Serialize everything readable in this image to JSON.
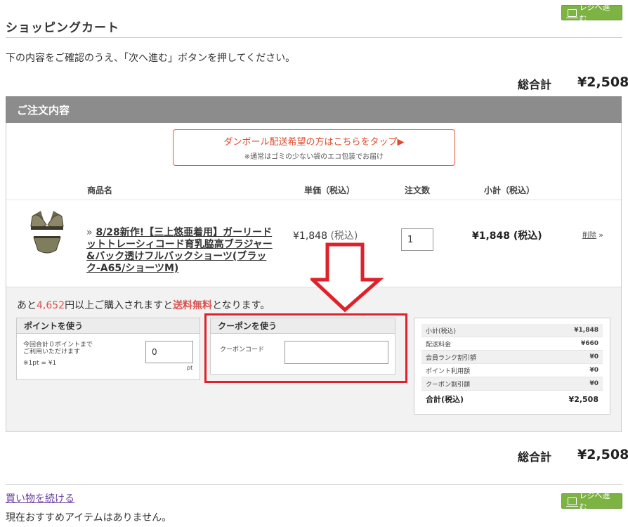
{
  "header": {
    "title": "ショッピングカート",
    "checkout_button": "レジへ進む"
  },
  "instruction": "下の内容をご確認のうえ、「次へ進む」ボタンを押してください。",
  "grand_total": {
    "label": "総合計",
    "value": "¥2,508"
  },
  "order": {
    "heading": "ご注文内容",
    "banner": {
      "line1": "ダンボール配送希望の方はこちらをタップ▶",
      "line2": "※通常はゴミの少ない袋のエコ包装でお届け"
    },
    "columns": {
      "product": "商品名",
      "unit_price": "単価（税込）",
      "quantity": "注文数",
      "subtotal": "小計（税込）"
    },
    "item": {
      "bullet": "»",
      "name": "8/28新作!【三上悠亜着用】ガーリードットトレーシィコード育乳脇高ブラジャー&バック透けフルバックショーツ(ブラック-A65/ショーツM)",
      "unit_price": "¥1,848",
      "unit_price_tax": "(税込)",
      "quantity": "1",
      "subtotal": "¥1,848 (税込)",
      "delete_label": "削除",
      "delete_arrow": "»"
    },
    "free_shipping": {
      "prefix": "あと",
      "amount": "4,652",
      "middle": "円以上ご購入されますと",
      "highlight": "送料無料",
      "suffix": "となります。"
    },
    "points": {
      "heading": "ポイントを使う",
      "desc_line1": "今回合計０ポイントまで",
      "desc_line2": "ご利用いただけます",
      "rate": "※1pt = ¥1",
      "value": "0",
      "unit": "pt"
    },
    "coupon": {
      "heading": "クーポンを使う",
      "code_label": "クーポンコード",
      "value": ""
    },
    "summary": {
      "rows": [
        {
          "label": "小計(税込)",
          "value": "¥1,848"
        },
        {
          "label": "配送料金",
          "value": "¥660"
        },
        {
          "label": "会員ランク割引額",
          "value": "¥0"
        },
        {
          "label": "ポイント利用額",
          "value": "¥0"
        },
        {
          "label": "クーポン割引額",
          "value": "¥0"
        }
      ],
      "total_label": "合計(税込)",
      "total_value": "¥2,508"
    }
  },
  "footer": {
    "continue_shopping": "買い物を続ける",
    "no_recommend": "現在おすすめアイテムはありません。",
    "checkout_button": "レジへ進む"
  },
  "annotation": {
    "color": "#e0202a"
  },
  "colors": {
    "accent_green": "#7cb342",
    "price_red": "#d9534f",
    "header_gray": "#8c8c8c"
  }
}
